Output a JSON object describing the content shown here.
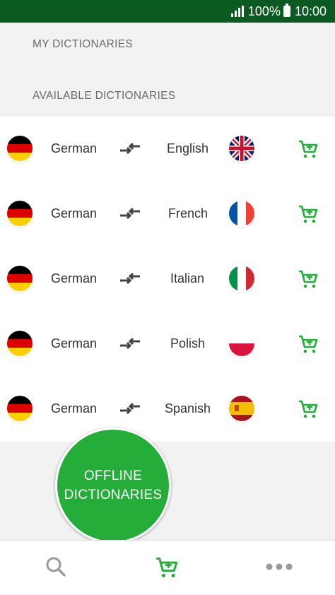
{
  "status": {
    "battery": "100%",
    "time": "10:00"
  },
  "sections": {
    "my_dictionaries": "MY DICTIONARIES",
    "available_dictionaries": "AVAILABLE DICTIONARIES"
  },
  "dictionaries": [
    {
      "source": "German",
      "target": "English",
      "target_flag": "uk-flag-icon"
    },
    {
      "source": "German",
      "target": "French",
      "target_flag": "france-flag-icon"
    },
    {
      "source": "German",
      "target": "Italian",
      "target_flag": "italy-flag-icon"
    },
    {
      "source": "German",
      "target": "Polish",
      "target_flag": "poland-flag-icon"
    },
    {
      "source": "German",
      "target": "Spanish",
      "target_flag": "spain-flag-icon"
    }
  ],
  "fab": {
    "label": "OFFLINE\nDICTIONARIES"
  },
  "nav": {
    "items": [
      "search-icon",
      "cart-icon",
      "more-icon"
    ],
    "active": "cart-icon"
  },
  "colors": {
    "status_bar": "#0b5a21",
    "accent": "#25ad3a",
    "text": "#333333",
    "header_text": "#6b6b6b"
  }
}
